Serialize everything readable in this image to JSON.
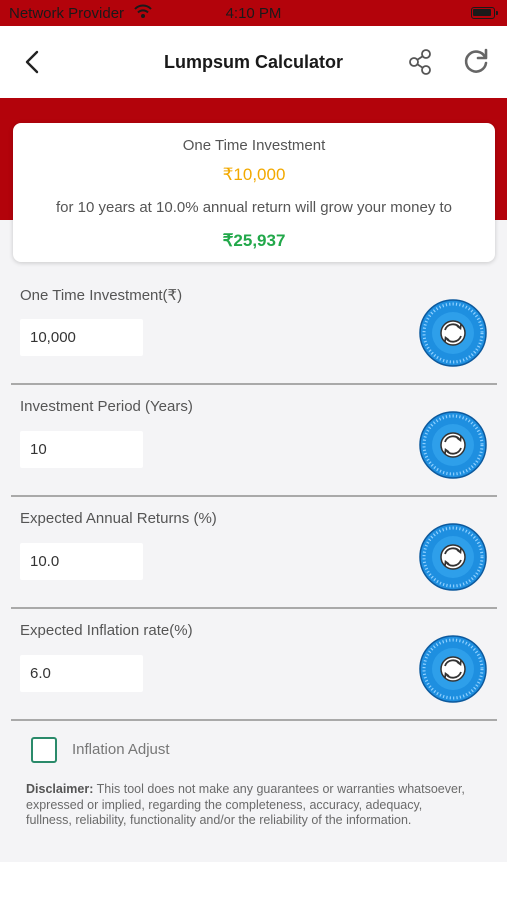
{
  "status_bar": {
    "carrier": "Network Provider",
    "time": "4:10 PM",
    "icons": [
      "wifi-icon",
      "battery-icon"
    ]
  },
  "nav": {
    "title": "Lumpsum Calculator",
    "icons": [
      "back-chevron-icon",
      "share-icon",
      "refresh-icon"
    ]
  },
  "summary": {
    "label": "One Time Investment",
    "amount": "₹10,000",
    "description": "for 10 years at 10.0% annual return will grow your money to",
    "result": "₹25,937"
  },
  "fields": [
    {
      "label": "One Time Investment(₹)",
      "value": "10,000"
    },
    {
      "label": "Investment Period (Years)",
      "value": "10"
    },
    {
      "label": "Expected Annual Returns (%)",
      "value": "10.0"
    },
    {
      "label": "Expected Inflation rate(%)",
      "value": "6.0"
    }
  ],
  "inflation_adjust": {
    "label": "Inflation Adjust",
    "checked": false
  },
  "disclaimer": {
    "heading": "Disclaimer:",
    "text": " This tool does not make any guarantees or warranties whatsoever, expressed or implied, regarding the completeness, accuracy, adequacy, fullness, reliability, functionality and/or the reliability of the information."
  },
  "colors": {
    "brand_red": "#b3030b",
    "investment_amount": "#f2a900",
    "result_amount": "#22a84a",
    "dial_blue": "#1e8fe0",
    "checkbox_green": "#2a8a6a"
  }
}
